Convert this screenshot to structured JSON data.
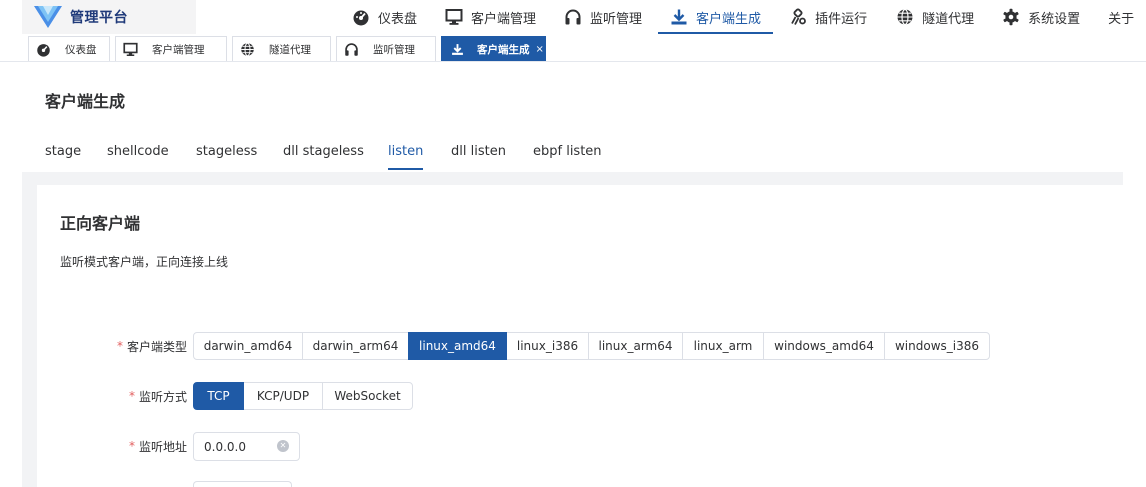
{
  "brand": {
    "title": "管理平台",
    "logo": "triangle-v-logo"
  },
  "menu": [
    {
      "label": "仪表盘",
      "icon": "dashboard-icon"
    },
    {
      "label": "客户端管理",
      "icon": "monitor-icon"
    },
    {
      "label": "监听管理",
      "icon": "headphones-icon"
    },
    {
      "label": "客户端生成",
      "icon": "download-icon",
      "active": true
    },
    {
      "label": "插件运行",
      "icon": "plugin-icon"
    },
    {
      "label": "隧道代理",
      "icon": "globe-icon"
    },
    {
      "label": "系统设置",
      "icon": "gear-icon"
    },
    {
      "label": "关于"
    }
  ],
  "tags": [
    {
      "label": "仪表盘",
      "icon": "dashboard-icon"
    },
    {
      "label": "客户端管理",
      "icon": "monitor-icon"
    },
    {
      "label": "隧道代理",
      "icon": "globe-icon"
    },
    {
      "label": "监听管理",
      "icon": "headphones-icon"
    },
    {
      "label": "客户端生成",
      "icon": "download-icon",
      "active": true,
      "close": "×"
    }
  ],
  "page": {
    "title": "客户端生成"
  },
  "tabs": [
    {
      "label": "stage"
    },
    {
      "label": "shellcode"
    },
    {
      "label": "stageless"
    },
    {
      "label": "dll stageless"
    },
    {
      "label": "listen",
      "active": true
    },
    {
      "label": "dll listen"
    },
    {
      "label": "ebpf listen"
    }
  ],
  "section": {
    "title": "正向客户端",
    "desc": "监听模式客户端，正向连接上线"
  },
  "form": {
    "required_mark": "*",
    "client_type": {
      "label": "客户端类型",
      "options": [
        "darwin_amd64",
        "darwin_arm64",
        "linux_amd64",
        "linux_i386",
        "linux_arm64",
        "linux_arm",
        "windows_amd64",
        "windows_i386"
      ],
      "selected": "linux_amd64"
    },
    "listen_mode": {
      "label": "监听方式",
      "options": [
        "TCP",
        "KCP/UDP",
        "WebSocket"
      ],
      "selected": "TCP"
    },
    "listen_addr": {
      "label": "监听地址",
      "value": "0.0.0.0",
      "clear_icon": "clear-circle-icon"
    }
  },
  "colors": {
    "accent": "#1f5aa6",
    "brand_text": "#1f3a7a",
    "required": "#e25f5f",
    "border": "#dcdfe6",
    "content_bg": "#f2f3f5"
  }
}
